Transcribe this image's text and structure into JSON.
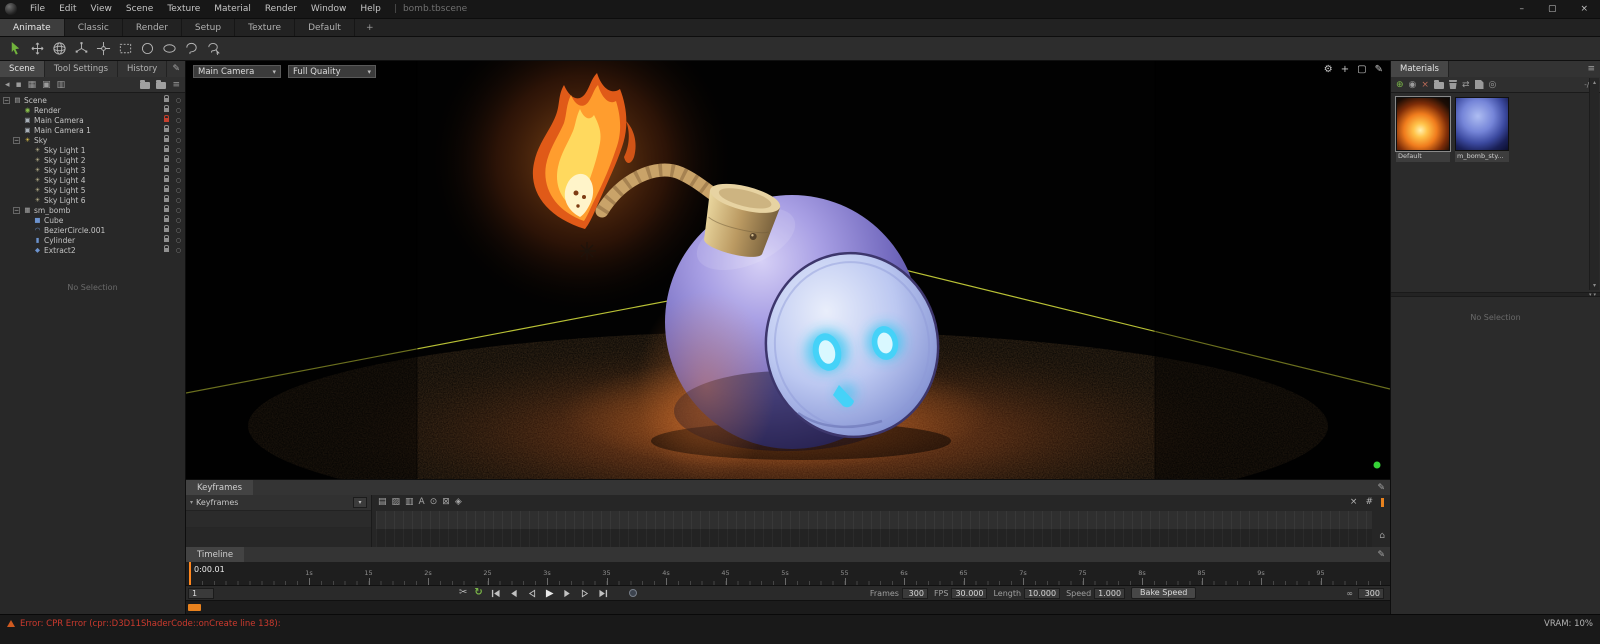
{
  "titlebar": {
    "menus": [
      "File",
      "Edit",
      "View",
      "Scene",
      "Texture",
      "Material",
      "Render",
      "Window",
      "Help"
    ],
    "separator": "|",
    "document": "bomb.tbscene",
    "window_buttons": {
      "minimize": "–",
      "maximize": "▢",
      "close": "×"
    }
  },
  "workspace_tabs": {
    "items": [
      "Animate",
      "Classic",
      "Render",
      "Setup",
      "Texture",
      "Default"
    ],
    "active": "Animate",
    "add_label": "+"
  },
  "left_panel": {
    "tabs": [
      {
        "label": "Scene",
        "active": true
      },
      {
        "label": "Tool Settings",
        "active": false
      },
      {
        "label": "History",
        "active": false
      }
    ],
    "icon_map": {
      "scene": [
        "▤",
        "#a8a8a8"
      ],
      "render": [
        "◉",
        "#86bb4a"
      ],
      "camera": [
        "▣",
        "#a8b0b8"
      ],
      "sun": [
        "☀",
        "#ddc14a"
      ],
      "light": [
        "☀",
        "#b8b08a"
      ],
      "mesh": [
        "▦",
        "#a8a8a8"
      ],
      "cube": [
        "■",
        "#6c93cf"
      ],
      "curve": [
        "◠",
        "#6c93cf"
      ],
      "cylinder": [
        "▮",
        "#6c93cf"
      ],
      "extract": [
        "◆",
        "#6c93cf"
      ]
    },
    "tree": [
      {
        "label": "Scene",
        "depth": 0,
        "icon": "scene",
        "expander": true
      },
      {
        "label": "Render",
        "depth": 1,
        "icon": "render"
      },
      {
        "label": "Main Camera",
        "depth": 1,
        "icon": "camera",
        "lock": "red"
      },
      {
        "label": "Main Camera 1",
        "depth": 1,
        "icon": "camera"
      },
      {
        "label": "Sky",
        "depth": 1,
        "icon": "sun",
        "expander": true
      },
      {
        "label": "Sky Light 1",
        "depth": 2,
        "icon": "light"
      },
      {
        "label": "Sky Light 2",
        "depth": 2,
        "icon": "light"
      },
      {
        "label": "Sky Light 3",
        "depth": 2,
        "icon": "light"
      },
      {
        "label": "Sky Light 4",
        "depth": 2,
        "icon": "light"
      },
      {
        "label": "Sky Light 5",
        "depth": 2,
        "icon": "light"
      },
      {
        "label": "Sky Light 6",
        "depth": 2,
        "icon": "light"
      },
      {
        "label": "sm_bomb",
        "depth": 1,
        "icon": "mesh",
        "expander": true
      },
      {
        "label": "Cube",
        "depth": 2,
        "icon": "cube"
      },
      {
        "label": "BezierCircle.001",
        "depth": 2,
        "icon": "curve"
      },
      {
        "label": "Cylinder",
        "depth": 2,
        "icon": "cylinder"
      },
      {
        "label": "Extract2",
        "depth": 2,
        "icon": "extract"
      }
    ],
    "empty_text": "No Selection"
  },
  "viewport": {
    "camera_select": "Main Camera",
    "quality_select": "Full Quality"
  },
  "materials_panel": {
    "tab": "Materials",
    "size_toggle": "-/+",
    "items": [
      {
        "name": "Default",
        "thumb": "flame",
        "selected": true
      },
      {
        "name": "m_bomb_sty...",
        "thumb": "bomb",
        "selected": false
      }
    ],
    "empty_text": "No Selection"
  },
  "keyframes_panel": {
    "title": "Keyframes",
    "group_label": "Keyframes"
  },
  "timeline_panel": {
    "title": "Timeline",
    "current_time": "0:00.01",
    "current_frame": "1",
    "ticks": [
      {
        "t": 1,
        "label": "1s"
      },
      {
        "t": 1.5,
        "label": "15"
      },
      {
        "t": 2,
        "label": "2s"
      },
      {
        "t": 2.5,
        "label": "25"
      },
      {
        "t": 3,
        "label": "3s"
      },
      {
        "t": 3.5,
        "label": "35"
      },
      {
        "t": 4,
        "label": "4s"
      },
      {
        "t": 4.5,
        "label": "45"
      },
      {
        "t": 5,
        "label": "5s"
      },
      {
        "t": 5.5,
        "label": "55"
      },
      {
        "t": 6,
        "label": "6s"
      },
      {
        "t": 6.5,
        "label": "65"
      },
      {
        "t": 7,
        "label": "7s"
      },
      {
        "t": 7.5,
        "label": "75"
      },
      {
        "t": 8,
        "label": "8s"
      },
      {
        "t": 8.5,
        "label": "85"
      },
      {
        "t": 9,
        "label": "9s"
      },
      {
        "t": 9.5,
        "label": "95"
      }
    ],
    "fields": [
      {
        "label": "Frames",
        "value": "300"
      },
      {
        "label": "FPS",
        "value": "30.000"
      },
      {
        "label": "Length",
        "value": "10.000"
      },
      {
        "label": "Speed",
        "value": "1.000"
      }
    ],
    "bake_button": "Bake Speed",
    "end_frame": "300"
  },
  "status_bar": {
    "error_text": "Error: CPR Error (cpr::D3D11ShaderCode::onCreate line 138):",
    "vram_text": "VRAM: 10%"
  },
  "colors": {
    "accent_orange": "#e8821e",
    "wireframe_yellow": "#d8e23e",
    "viewport_dot_green": "#36d337"
  },
  "glyphs": {
    "expander": "−",
    "visibility": "○",
    "caret": "▾",
    "edit": "✎",
    "gear": "⚙",
    "frame": "▢",
    "move": "+",
    "scissors": "✂",
    "loop": "↻",
    "home": "⌂",
    "link": "∞",
    "clear": "×",
    "hash": "#",
    "up": "▴",
    "down": "▾",
    "back": "◂",
    "menu": "≡",
    "add": "⊕",
    "sphere": "◉",
    "lib": "◎",
    "sync": "⇄",
    "pin": "▪",
    "grid": "▦",
    "cards": "▣",
    "rows": "▥",
    "kf1": "▤",
    "kf2": "▨",
    "kf3": "▥",
    "kf4": "A",
    "kf5": "⊙",
    "kf6": "⊠",
    "kf7": "◈"
  }
}
